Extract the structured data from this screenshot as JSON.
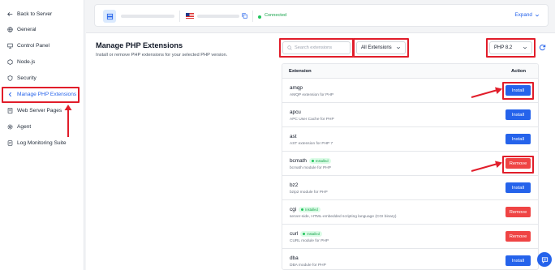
{
  "sidebar": {
    "back_label": "Back to Server",
    "items": [
      {
        "label": "General",
        "icon": "globe-icon"
      },
      {
        "label": "Control Panel",
        "icon": "monitor-icon"
      },
      {
        "label": "Node.js",
        "icon": "nodejs-icon"
      },
      {
        "label": "Security",
        "icon": "shield-icon"
      },
      {
        "label": "Manage PHP Extensions",
        "icon": "php-extension-icon",
        "active": true
      },
      {
        "label": "Web Server Pages",
        "icon": "page-icon"
      },
      {
        "label": "Agent",
        "icon": "gear-icon"
      },
      {
        "label": "Log Monitoring Suite",
        "icon": "log-icon"
      }
    ]
  },
  "header": {
    "status": "Connected",
    "expand_label": "Expand"
  },
  "page": {
    "title": "Manage PHP Extensions",
    "subtitle": "Install or remove PHP extensions for your selected PHP version."
  },
  "filters": {
    "search_placeholder": "Search extensions",
    "filter_selected": "All Extensions",
    "php_version": "PHP 8.2"
  },
  "table": {
    "col_extension": "Extension",
    "col_action": "Action",
    "installed_badge": "Installed",
    "rows": [
      {
        "name": "amqp",
        "desc": "AMQP extension for PHP",
        "installed": false,
        "action": "Install"
      },
      {
        "name": "apcu",
        "desc": "APC User Cache for PHP",
        "installed": false,
        "action": "Install"
      },
      {
        "name": "ast",
        "desc": "AST extension for PHP 7",
        "installed": false,
        "action": "Install"
      },
      {
        "name": "bcmath",
        "desc": "bcmath module for PHP",
        "installed": true,
        "action": "Remove"
      },
      {
        "name": "bz2",
        "desc": "bzip2 module for PHP",
        "installed": false,
        "action": "Install"
      },
      {
        "name": "cgi",
        "desc": "server-side, HTML-embedded scripting language (CGI binary)",
        "installed": true,
        "action": "Remove"
      },
      {
        "name": "curl",
        "desc": "CURL module for PHP",
        "installed": true,
        "action": "Remove"
      },
      {
        "name": "dba",
        "desc": "DBA module for PHP",
        "installed": false,
        "action": "Install"
      }
    ]
  },
  "colors": {
    "accent": "#2563eb",
    "danger": "#ef4444",
    "success": "#16a34a",
    "annotation": "#e11d2a"
  }
}
